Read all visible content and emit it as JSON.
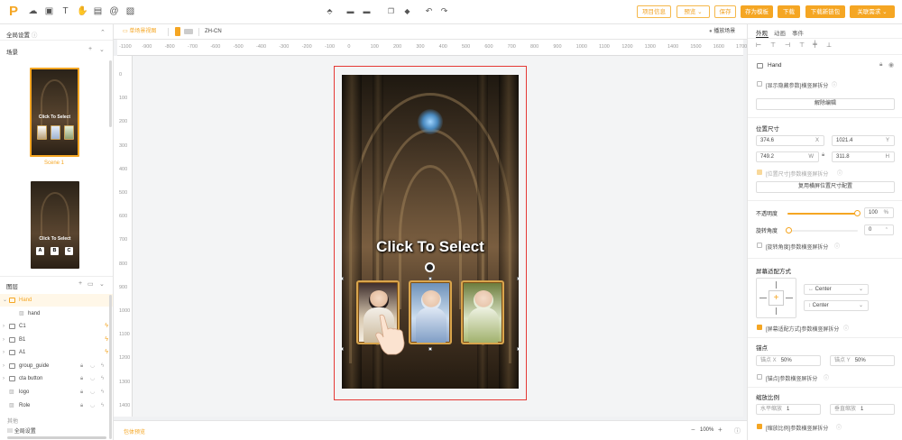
{
  "topbar": {
    "project_info": "项目信息",
    "preview": "预览",
    "save": "保存",
    "save_as_template": "存为模板",
    "download": "下载",
    "download_new": "下载新链包",
    "related_request": "关联需求"
  },
  "left_panel": {
    "global_settings": "全局设置",
    "scenes_title": "场景",
    "scene1_label": "Scene 1",
    "scene1_text": "Click To Select",
    "scene2_text": "Click To Select",
    "scene2_keys": [
      "A",
      "B",
      "C"
    ],
    "layers_title": "图层",
    "layers": [
      {
        "label": "Hand"
      },
      {
        "label": "hand"
      },
      {
        "label": "C1"
      },
      {
        "label": "B1"
      },
      {
        "label": "A1"
      },
      {
        "label": "group_guide"
      },
      {
        "label": "cta button"
      },
      {
        "label": "logo"
      },
      {
        "label": "Role"
      }
    ],
    "other_title": "其他",
    "global_settings_item": "全局设置"
  },
  "mid_toolbar": {
    "single_scene_view": "单场景视图",
    "language": "ZH-CN",
    "play_scene": "播放场景"
  },
  "rulers": {
    "top": [
      "-1100",
      "-900",
      "-800",
      "-700",
      "-600",
      "-500",
      "-400",
      "-300",
      "-200",
      "-100",
      "0",
      "100",
      "200",
      "300",
      "400",
      "500",
      "600",
      "700",
      "800",
      "900",
      "1000",
      "1100",
      "1200",
      "1300",
      "1400",
      "1500",
      "1600",
      "1700"
    ],
    "left": [
      "0",
      "100",
      "200",
      "300",
      "400",
      "500",
      "600",
      "700",
      "800",
      "900",
      "1000",
      "1100",
      "1200",
      "1300",
      "1400"
    ]
  },
  "canvas": {
    "title": "Click To Select"
  },
  "bottom": {
    "package_preview": "包体预览",
    "zoom": "100%"
  },
  "right_panel": {
    "tabs": [
      "外观",
      "动画",
      "事件"
    ],
    "node_name": "Hand",
    "show_hidden_param": "[显示隐藏参数]横竖屏拆分",
    "unlock_edit": "解除编辑",
    "pos_size_title": "位置尺寸",
    "x_value": "374.6",
    "x_unit": "X",
    "y_value": "1021.4",
    "y_unit": "Y",
    "w_value": "749.2",
    "w_unit": "W",
    "h_value": "311.8",
    "h_unit": "H",
    "pos_split": "[位置尺寸]参数横竖屏拆分",
    "reuse_config": "复用横屏位置尺寸配置",
    "opacity_label": "不透明度",
    "opacity_value": "100",
    "opacity_unit": "%",
    "opacity_fraction": 1.0,
    "rotation_label": "旋转角度",
    "rotation_value": "0",
    "rotation_split": "[旋转角度]参数横竖屏拆分",
    "screen_adapt_title": "屏幕适配方式",
    "h_align": "Center",
    "v_align": "Center",
    "screen_adapt_split": "[屏幕适配方式]参数横竖屏拆分",
    "anchor_title": "锚点",
    "anchor_x_label": "锚点 X",
    "anchor_x": "50%",
    "anchor_y_label": "锚点 Y",
    "anchor_y": "50%",
    "anchor_split": "[锚点]参数横竖屏拆分",
    "scale_title": "缩放比例",
    "scale_h_label": "水平缩放",
    "scale_h": "1",
    "scale_v_label": "垂直缩放",
    "scale_v": "1",
    "scale_split": "[缩放比例]参数横竖屏拆分"
  },
  "colors": {
    "accent": "#f5a623",
    "selection": "#e53935"
  }
}
